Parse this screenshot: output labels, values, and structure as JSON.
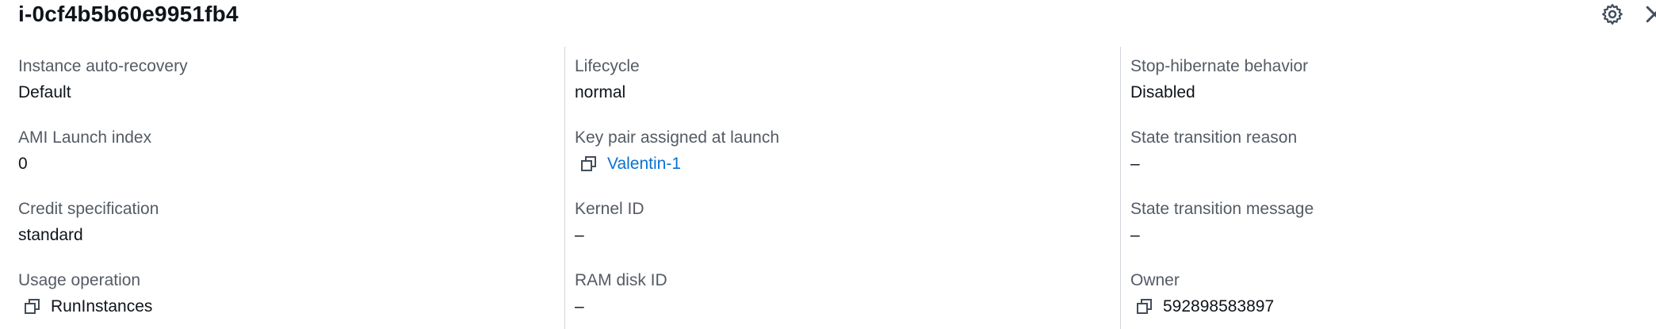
{
  "header": {
    "title": "i-0cf4b5b60e9951fb4",
    "settings_icon": "gear-icon",
    "close_icon": "close-icon"
  },
  "columns": [
    {
      "fields": [
        {
          "label": "Instance auto-recovery",
          "value": "Default"
        },
        {
          "label": "AMI Launch index",
          "value": "0"
        },
        {
          "label": "Credit specification",
          "value": "standard"
        },
        {
          "label": "Usage operation",
          "value": "RunInstances",
          "copyable": true
        }
      ]
    },
    {
      "fields": [
        {
          "label": "Lifecycle",
          "value": "normal"
        },
        {
          "label": "Key pair assigned at launch",
          "value": "Valentin-1",
          "copyable": true,
          "link": true
        },
        {
          "label": "Kernel ID",
          "value": "–"
        },
        {
          "label": "RAM disk ID",
          "value": "–"
        }
      ]
    },
    {
      "fields": [
        {
          "label": "Stop-hibernate behavior",
          "value": "Disabled"
        },
        {
          "label": "State transition reason",
          "value": "–"
        },
        {
          "label": "State transition message",
          "value": "–"
        },
        {
          "label": "Owner",
          "value": "592898583897",
          "copyable": true
        }
      ]
    }
  ],
  "colors": {
    "link": "#0972d3",
    "label": "#545b64",
    "text": "#0f141a",
    "divider": "#d1d5db"
  }
}
